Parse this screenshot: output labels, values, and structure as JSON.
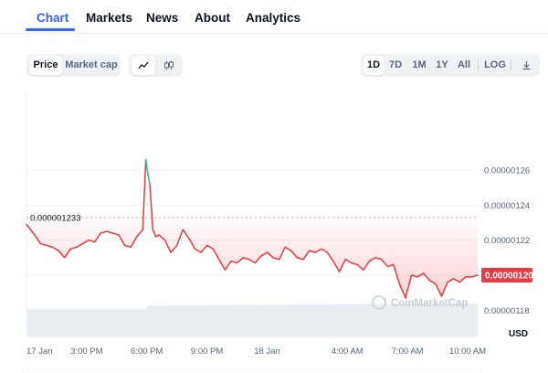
{
  "tabs": [
    {
      "label": "Chart",
      "active": true
    },
    {
      "label": "Markets"
    },
    {
      "label": "News"
    },
    {
      "label": "About"
    },
    {
      "label": "Analytics"
    }
  ],
  "toolbar": {
    "metric_buttons": [
      "Price",
      "Market cap"
    ],
    "metric_selected": "Price",
    "chart_type_icons": [
      "line-chart-icon",
      "candlestick-icon"
    ],
    "range_buttons": [
      "1D",
      "7D",
      "1M",
      "1Y",
      "All"
    ],
    "range_selected": "1D",
    "log_label": "LOG",
    "download_icon": "download-icon"
  },
  "chart_data": {
    "type": "line",
    "currency_label": "USD",
    "watermark": "CoinMarketCap",
    "open_price_label": "0.000001233",
    "current_price_label": "0.00000120",
    "y_tick_labels": [
      "0.00000126",
      "0.00000124",
      "0.00000122",
      "0.00000120",
      "0.00000118"
    ],
    "y_ticks": [
      1.26e-06,
      1.24e-06,
      1.22e-06,
      1.2e-06,
      1.18e-06
    ],
    "ylim": [
      1.165e-06,
      1.305e-06
    ],
    "x_tick_labels": [
      "17 Jan",
      "3:00 PM",
      "6:00 PM",
      "9:00 PM",
      "18 Jan",
      "4:00 AM",
      "7:00 AM",
      "10:00 AM"
    ],
    "x_tick_hours": [
      0,
      3,
      6,
      9,
      12,
      16,
      19,
      22
    ],
    "x_range_hours": [
      0,
      22.5
    ],
    "open_price": 1.233e-06,
    "current_price": 1.2e-06,
    "colors": {
      "up": "#16c784",
      "down": "#ea3943",
      "grid": "#eff2f5",
      "volume": "#e9edf2",
      "watermark": "#c8ced6"
    },
    "series": [
      {
        "x": [
          0,
          0.4,
          0.7,
          1,
          1.3,
          1.6,
          1.9,
          2.2,
          2.5,
          2.8,
          3.1,
          3.4,
          3.7,
          4.0,
          4.3,
          4.6,
          4.9,
          5.2,
          5.5,
          5.8,
          5.95,
          6.0,
          6.05,
          6.15,
          6.3,
          6.45,
          6.6,
          6.9,
          7.2,
          7.5,
          7.8,
          8.1,
          8.4,
          8.7,
          9.0,
          9.3,
          9.6,
          9.9,
          10.2,
          10.5,
          10.8,
          11.1,
          11.4,
          11.7,
          12.0,
          12.3,
          12.6,
          12.9,
          13.2,
          13.5,
          13.8,
          14.1,
          14.4,
          14.7,
          15.0,
          15.3,
          15.6,
          15.9,
          16.2,
          16.5,
          16.8,
          17.1,
          17.4,
          17.7,
          18.0,
          18.3,
          18.6,
          18.9,
          19.2,
          19.5,
          19.8,
          20.1,
          20.4,
          20.7,
          21.0,
          21.3,
          21.6,
          21.9,
          22.2,
          22.5
        ],
        "y": [
          1.229e-06,
          1.223e-06,
          1.218e-06,
          1.217e-06,
          1.216e-06,
          1.214e-06,
          1.21e-06,
          1.215e-06,
          1.216e-06,
          1.218e-06,
          1.22e-06,
          1.219e-06,
          1.224e-06,
          1.225e-06,
          1.224e-06,
          1.223e-06,
          1.217e-06,
          1.216e-06,
          1.222e-06,
          1.226e-06,
          1.266e-06,
          1.262e-06,
          1.258e-06,
          1.252e-06,
          1.226e-06,
          1.222e-06,
          1.223e-06,
          1.22e-06,
          1.213e-06,
          1.217e-06,
          1.226e-06,
          1.221e-06,
          1.215e-06,
          1.213e-06,
          1.217e-06,
          1.215e-06,
          1.209e-06,
          1.203e-06,
          1.208e-06,
          1.207e-06,
          1.21e-06,
          1.209e-06,
          1.207e-06,
          1.211e-06,
          1.213e-06,
          1.21e-06,
          1.209e-06,
          1.216e-06,
          1.214e-06,
          1.21e-06,
          1.209e-06,
          1.214e-06,
          1.213e-06,
          1.215e-06,
          1.213e-06,
          1.208e-06,
          1.202e-06,
          1.209e-06,
          1.207e-06,
          1.206e-06,
          1.203e-06,
          1.208e-06,
          1.21e-06,
          1.209e-06,
          1.205e-06,
          1.206e-06,
          1.195e-06,
          1.187e-06,
          1.2e-06,
          1.199e-06,
          1.201e-06,
          1.197e-06,
          1.195e-06,
          1.188e-06,
          1.196e-06,
          1.198e-06,
          1.196e-06,
          1.199e-06,
          1.199e-06,
          1.2e-06
        ]
      }
    ]
  }
}
